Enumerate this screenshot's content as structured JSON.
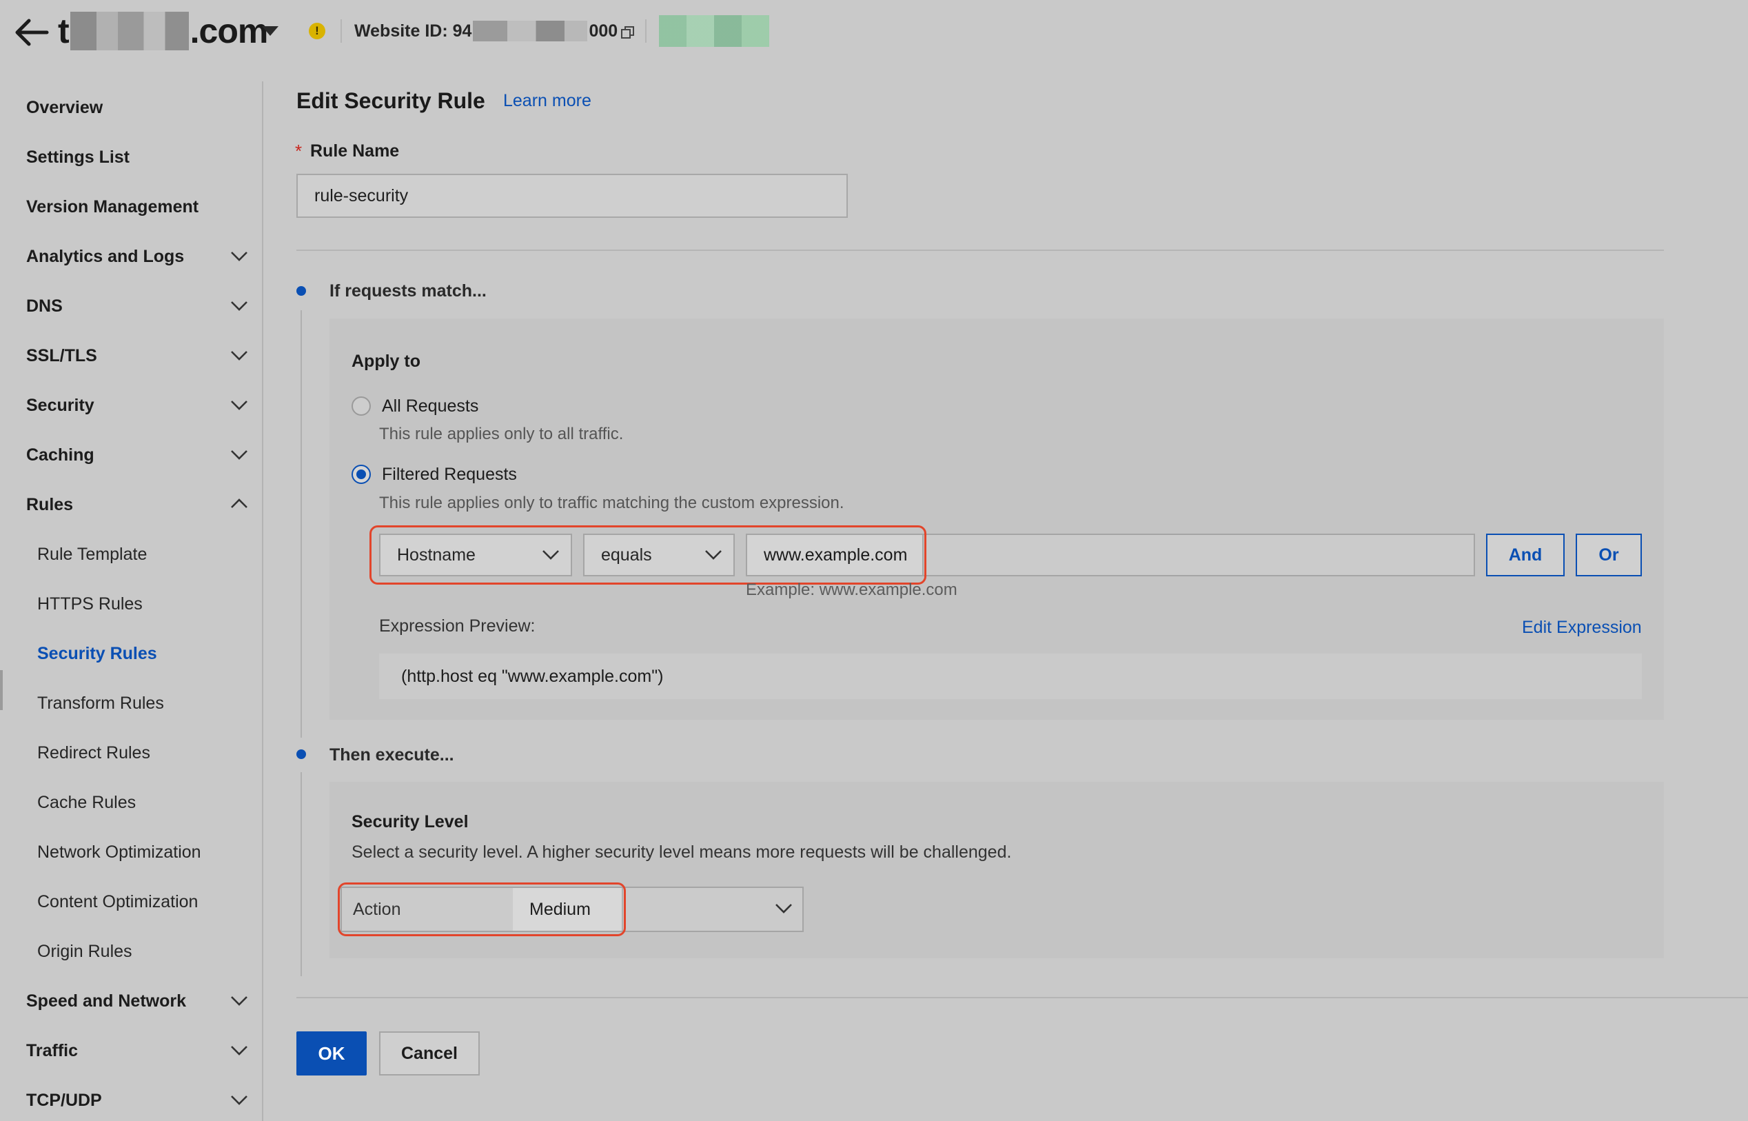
{
  "header": {
    "site_prefix": "t",
    "site_suffix": ".com",
    "website_id_label": "Website ID: 94",
    "website_id_suffix": "000"
  },
  "sidebar": {
    "items": [
      {
        "label": "Overview"
      },
      {
        "label": "Settings List"
      },
      {
        "label": "Version Management"
      },
      {
        "label": "Analytics and Logs",
        "expandable": true
      },
      {
        "label": "DNS",
        "expandable": true
      },
      {
        "label": "SSL/TLS",
        "expandable": true
      },
      {
        "label": "Security",
        "expandable": true
      },
      {
        "label": "Caching",
        "expandable": true
      },
      {
        "label": "Rules",
        "expanded": true
      },
      {
        "label": "Speed and Network",
        "expandable": true
      },
      {
        "label": "Traffic",
        "expandable": true
      },
      {
        "label": "TCP/UDP",
        "expandable": true
      }
    ],
    "rules_children": [
      {
        "label": "Rule Template"
      },
      {
        "label": "HTTPS Rules"
      },
      {
        "label": "Security Rules",
        "active": true
      },
      {
        "label": "Transform Rules"
      },
      {
        "label": "Redirect Rules"
      },
      {
        "label": "Cache Rules"
      },
      {
        "label": "Network Optimization"
      },
      {
        "label": "Content Optimization"
      },
      {
        "label": "Origin Rules"
      }
    ]
  },
  "form": {
    "title": "Edit Security Rule",
    "learn_more": "Learn more",
    "rule_name_label": "Rule Name",
    "rule_name_required": "*",
    "rule_name_value": "rule-security"
  },
  "match": {
    "step_title": "If requests match...",
    "apply_to_label": "Apply to",
    "all_requests_label": "All Requests",
    "all_requests_desc": "This rule applies only to all traffic.",
    "filtered_label": "Filtered Requests",
    "filtered_desc": "This rule applies only to traffic matching the custom expression.",
    "selected_option": "Filtered Requests",
    "field_select": "Hostname",
    "operator_select": "equals",
    "value": "www.example.com",
    "value_hint": "Example: www.example.com",
    "and_button": "And",
    "or_button": "Or",
    "preview_label": "Expression Preview:",
    "edit_expression": "Edit Expression",
    "preview_value": "(http.host eq \"www.example.com\")"
  },
  "execute": {
    "step_title": "Then execute...",
    "section_label": "Security Level",
    "description": "Select a security level. A higher security level means more requests will be challenged.",
    "action_label": "Action",
    "level_value": "Medium"
  },
  "footer": {
    "ok_button": "OK",
    "cancel_button": "Cancel"
  },
  "colors": {
    "accent": "#0a4fb3",
    "highlight": "#e2452b",
    "warning": "#d9b300"
  },
  "icons": [
    "back-arrow-icon",
    "caret-down-icon",
    "warning-icon",
    "copy-icon",
    "chevron-down-icon",
    "chevron-up-icon"
  ]
}
